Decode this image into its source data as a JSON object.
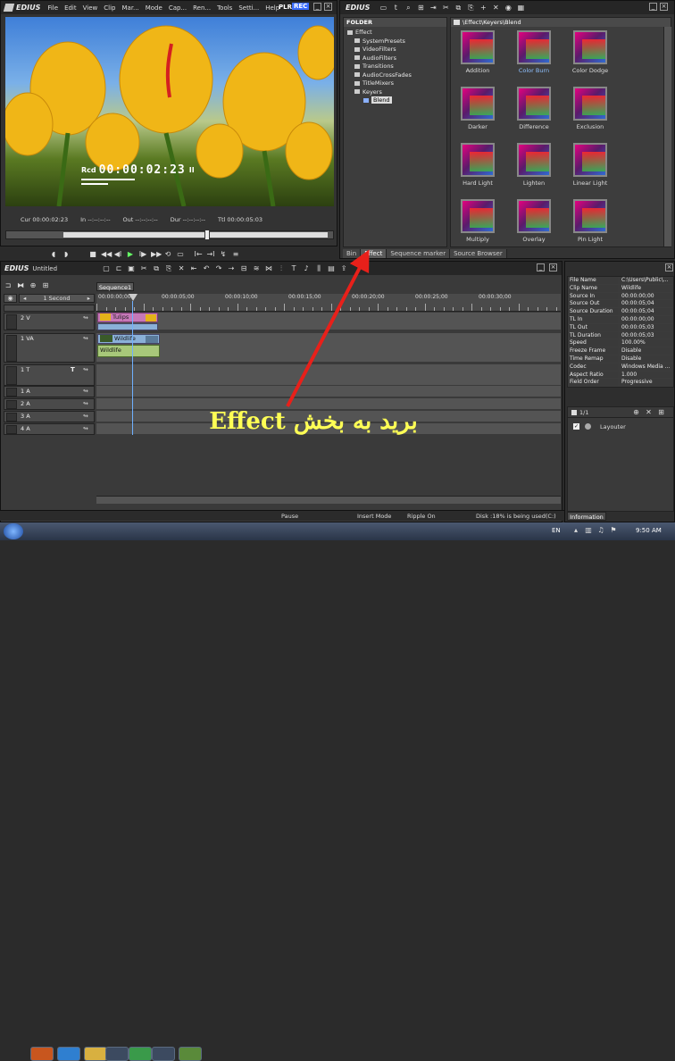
{
  "player": {
    "logo": "EDIUS",
    "menu": [
      "File",
      "Edit",
      "View",
      "Clip",
      "Mar...",
      "Mode",
      "Cap...",
      "Ren...",
      "Tools",
      "Setti...",
      "Help"
    ],
    "plr": "PLR",
    "rec": "REC",
    "timecode_label": "Rcd",
    "timecode": "00:00:02:23",
    "pause_glyph": "II",
    "cur_label": "Cur",
    "cur": "00:00:02:23",
    "in_label": "In",
    "in": "--:--:--:--",
    "out_label": "Out",
    "out": "--:--:--:--",
    "dur_label": "Dur",
    "dur": "--:--:--:--",
    "ttl_label": "Ttl",
    "ttl": "00:00:05:03"
  },
  "bin": {
    "logo": "EDIUS",
    "folder_header": "FOLDER",
    "path": "\\Effect\\Keyers\\Blend",
    "tree": [
      "Effect",
      "SystemPresets",
      "VideoFilters",
      "AudioFilters",
      "Transitions",
      "AudioCrossFades",
      "TitleMixers",
      "Keyers",
      "Blend"
    ],
    "effects": [
      "Addition",
      "Color Burn",
      "Color Dodge",
      "Darker",
      "Difference",
      "Exclusion",
      "Hard Light",
      "Lighten",
      "Linear Light",
      "Multiply",
      "Overlay",
      "Pin Light"
    ],
    "tabs": [
      "Bin",
      "Effect",
      "Sequence marker",
      "Source Browser"
    ]
  },
  "timeline": {
    "logo": "EDIUS",
    "project": "Untitled",
    "sequence_tab": "Sequence1",
    "scale": "1 Second",
    "ruler": [
      "00:00:00;00",
      "00:00:05;00",
      "00:00:10;00",
      "00:00:15;00",
      "00:00:20;00",
      "00:00:25;00",
      "00:00:30;00"
    ],
    "tracks": [
      {
        "name": "2 V"
      },
      {
        "name": "1 VA"
      },
      {
        "name": "1 T",
        "t": "T"
      },
      {
        "name": "1 A"
      },
      {
        "name": "2 A"
      },
      {
        "name": "3 A"
      },
      {
        "name": "4 A"
      }
    ],
    "clip_tulips": "Tulips",
    "clip_wildlife": "Wildlife",
    "clip_wildlife_audio": "Wildlife",
    "overlay_text": "برید به بخش Effect"
  },
  "info": {
    "rows": [
      [
        "File Name",
        "C:\\Users\\Public\\..."
      ],
      [
        "Clip Name",
        "Wildlife"
      ],
      [
        "Source In",
        "00:00:00;00"
      ],
      [
        "Source Out",
        "00:00:05;04"
      ],
      [
        "Source Duration",
        "00:00:05;04"
      ],
      [
        "TL In",
        "00:00:00;00"
      ],
      [
        "TL Out",
        "00:00:05;03"
      ],
      [
        "TL Duration",
        "00:00:05;03"
      ],
      [
        "Speed",
        "100.00%"
      ],
      [
        "Freeze Frame",
        "Disable"
      ],
      [
        "Time Remap",
        "Disable"
      ],
      [
        "Codec",
        "Windows Media ..."
      ],
      [
        "Aspect Ratio",
        "1.000"
      ],
      [
        "Field Order",
        "Progressive"
      ]
    ],
    "layer_count": "1/1",
    "layouter": "Layouter",
    "tab": "Information"
  },
  "status": {
    "pause": "Pause",
    "insert": "Insert Mode",
    "ripple": "Ripple On",
    "disk": "Disk :18% is being used(C:)"
  },
  "taskbar": {
    "lang": "EN",
    "time": "9:50 AM"
  },
  "colors": {
    "accent_red": "#e8201a",
    "overlay_text": "#ffff55",
    "rec_blue": "#3a6cff"
  }
}
